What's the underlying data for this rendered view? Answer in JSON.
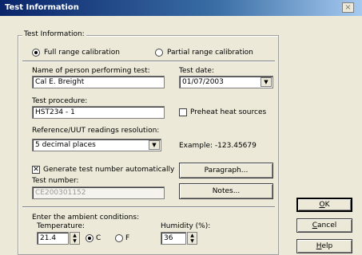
{
  "window": {
    "title": "Test Information",
    "close_glyph": "×"
  },
  "test_info": {
    "group_label": "Test Information:",
    "full_range": {
      "label": "Full range calibration",
      "selected": true
    },
    "partial_range": {
      "label": "Partial range calibration",
      "selected": false
    },
    "person_label": "Name of person performing test:",
    "person_value": "Cal E. Breight",
    "date_label": "Test date:",
    "date_value": "01/07/2003",
    "procedure_label": "Test procedure:",
    "procedure_value": "HST234 - 1",
    "preheat_label": "Preheat heat sources",
    "preheat_checked": false,
    "resolution_label": "Reference/UUT readings resolution:",
    "resolution_value": "5 decimal places",
    "example_text": "Example: -123.45679",
    "auto_number_label": "Generate test number automatically",
    "auto_number_checked": true,
    "test_number_label": "Test number:",
    "test_number_value": "CE200301152",
    "paragraph_button": "Paragraph...",
    "notes_button": "Notes..."
  },
  "ambient": {
    "prompt": "Enter the ambient conditions:",
    "temperature_label": "Temperature:",
    "temperature_value": "21.4",
    "unit_c": {
      "label": "C",
      "selected": true
    },
    "unit_f": {
      "label": "F",
      "selected": false
    },
    "humidity_label": "Humidity (%):",
    "humidity_value": "36"
  },
  "buttons": {
    "ok": {
      "first": "O",
      "rest": "K"
    },
    "cancel": {
      "first": "C",
      "rest": "ancel"
    },
    "help": {
      "first": "H",
      "rest": "elp"
    }
  },
  "icons": {
    "dropdown": "▼",
    "spin_up": "▲",
    "spin_down": "▼",
    "check": "✕"
  }
}
